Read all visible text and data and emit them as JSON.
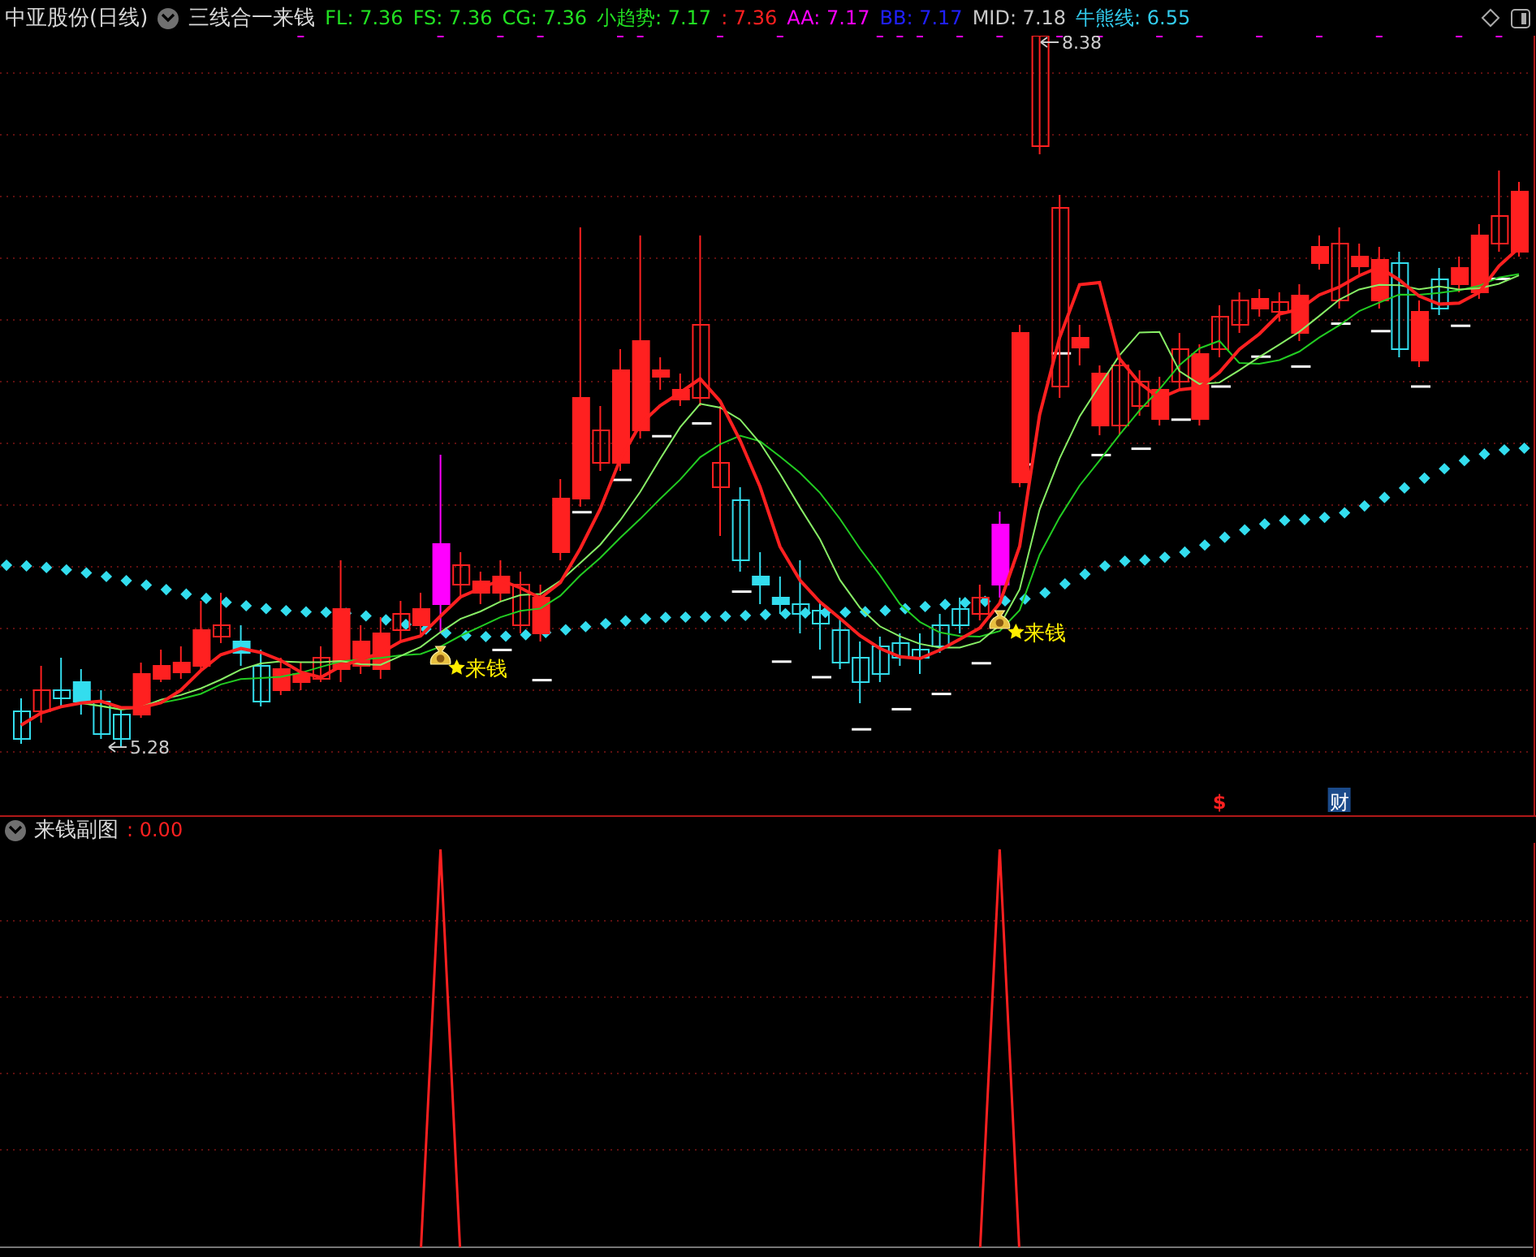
{
  "header": {
    "stock": "中亚股份(日线)",
    "indicator": "三线合一来钱",
    "values": [
      {
        "text": "FL: 7.36",
        "color": "#22e022"
      },
      {
        "text": "FS: 7.36",
        "color": "#22e022"
      },
      {
        "text": "CG: 7.36",
        "color": "#22e022"
      },
      {
        "text": "小趋势: 7.17",
        "color": "#22e022"
      },
      {
        "text": ": 7.36",
        "color": "#ff2020"
      },
      {
        "text": "AA: 7.17",
        "color": "#ff00ff"
      },
      {
        "text": "BB: 7.17",
        "color": "#2020ff"
      },
      {
        "text": "MID: 7.18",
        "color": "#c8c8c8"
      },
      {
        "text": "牛熊线: 6.55",
        "color": "#33ccee"
      }
    ]
  },
  "main_chart": {
    "high_label": "8.38",
    "low_label": "5.28",
    "signals": [
      {
        "text": "来钱"
      },
      {
        "text": "来钱"
      }
    ],
    "markers": [
      {
        "kind": "dollar",
        "text": "$"
      },
      {
        "kind": "cai",
        "text": "财"
      }
    ]
  },
  "sub_chart": {
    "title": "来钱副图",
    "value": ": 0.00"
  }
}
